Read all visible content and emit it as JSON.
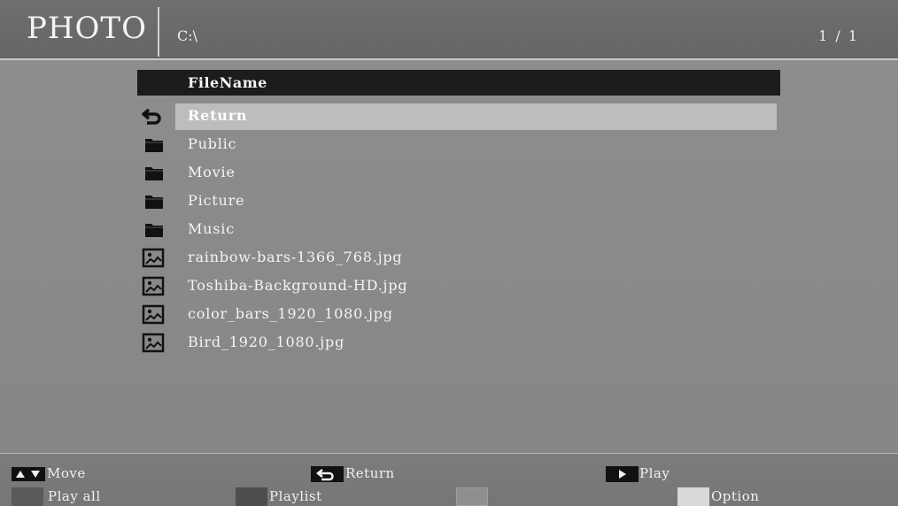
{
  "header": {
    "title": "PHOTO",
    "path": "C:\\",
    "page_counter": "1 / 1"
  },
  "list": {
    "column_header": "FileName",
    "items": [
      {
        "label": "Return",
        "type": "return",
        "icon": "return-icon",
        "selected": true
      },
      {
        "label": "Public",
        "type": "folder",
        "icon": "folder-icon"
      },
      {
        "label": "Movie",
        "type": "folder",
        "icon": "folder-icon"
      },
      {
        "label": "Picture",
        "type": "folder",
        "icon": "folder-icon"
      },
      {
        "label": "Music",
        "type": "folder",
        "icon": "folder-icon"
      },
      {
        "label": "rainbow-bars-1366_768.jpg",
        "type": "image",
        "icon": "image-file-icon"
      },
      {
        "label": "Toshiba-Background-HD.jpg",
        "type": "image",
        "icon": "image-file-icon"
      },
      {
        "label": "color_bars_1920_1080.jpg",
        "type": "image",
        "icon": "image-file-icon"
      },
      {
        "label": "Bird_1920_1080.jpg",
        "type": "image",
        "icon": "image-file-icon"
      }
    ]
  },
  "footer": {
    "move_label": "Move",
    "return_label": "Return",
    "play_label": "Play",
    "play_all_label": "Play all",
    "playlist_label": "Playlist",
    "option_label": "Option"
  },
  "colors": {
    "selected_row": "#bdbdbd",
    "header_bar": "#1c1c1c",
    "key_red": "#5a5a5a",
    "key_green": "#4e4e4e",
    "key_yellow": "#8f8f8f",
    "key_blue": "#d9d9d9"
  }
}
